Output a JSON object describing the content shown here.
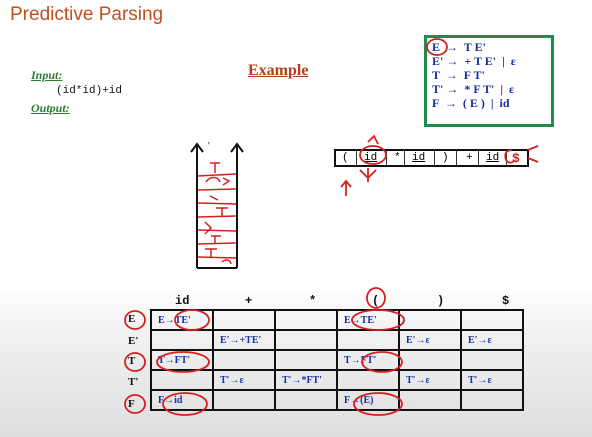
{
  "slide": {
    "title": "Predictive Parsing",
    "input_label": "Input:",
    "input_value": "(id*id)+id",
    "output_label": "Output:",
    "example_heading": "Example"
  },
  "grammar": [
    "E  →  T E'",
    "E' →  + T E'  |  ε",
    "T  →  F T'",
    "T' →  * F T'  |  ε",
    "F  →  ( E )  |  id"
  ],
  "tape": [
    "(",
    "id",
    "*",
    "id",
    ")",
    "+",
    "id",
    "$"
  ],
  "stack": {
    "top_mark": "'",
    "handwritten": [
      "T",
      "E'",
      ")",
      "T'",
      "F",
      "E'",
      "T'",
      "E'",
      "$"
    ]
  },
  "table": {
    "columns": [
      "id",
      "+",
      "*",
      "(",
      ")",
      "$"
    ],
    "rows": [
      {
        "nonterminal": "E",
        "cells": [
          "E→TE'",
          "",
          "",
          "E→TE'",
          "",
          ""
        ]
      },
      {
        "nonterminal": "E'",
        "cells": [
          "",
          "E'→+TE'",
          "",
          "",
          "E'→ε",
          "E'→ε"
        ]
      },
      {
        "nonterminal": "T",
        "cells": [
          "T→FT'",
          "",
          "",
          "T→FT'",
          "",
          ""
        ]
      },
      {
        "nonterminal": "T'",
        "cells": [
          "",
          "T'→ε",
          "T'→*FT'",
          "",
          "T'→ε",
          "T'→ε"
        ]
      },
      {
        "nonterminal": "F",
        "cells": [
          "F→id",
          "",
          "",
          "F→(E)",
          "",
          ""
        ]
      }
    ]
  },
  "colors": {
    "title": "#c0501f",
    "label": "#2e7d32",
    "grammar_border": "#1f8c4e",
    "production_text": "#1a2fa0",
    "annotation": "#d62020"
  }
}
